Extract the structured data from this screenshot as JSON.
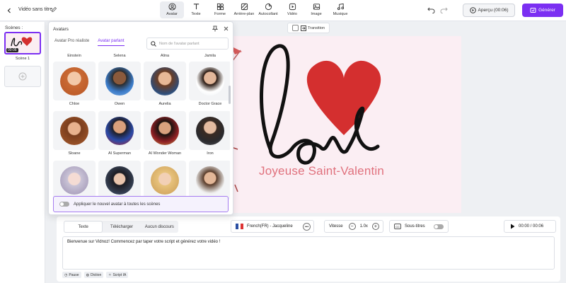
{
  "header": {
    "title": "Vidéo sans titre",
    "tools": [
      {
        "label": "Avatar",
        "icon": "user-circle-icon",
        "active": true
      },
      {
        "label": "Texte",
        "icon": "text-icon",
        "active": false
      },
      {
        "label": "Forme",
        "icon": "shapes-icon",
        "active": false
      },
      {
        "label": "Arrière-plan",
        "icon": "background-icon",
        "active": false
      },
      {
        "label": "Autocollant",
        "icon": "sticker-icon",
        "active": false
      },
      {
        "label": "Vidéo",
        "icon": "video-icon",
        "active": false
      },
      {
        "label": "Image",
        "icon": "image-icon",
        "active": false
      },
      {
        "label": "Musique",
        "icon": "music-icon",
        "active": false
      }
    ],
    "preview_label": "Aperçu (00:06)",
    "generate_label": "Générer"
  },
  "scenes": {
    "label": "Scènes :",
    "items": [
      {
        "name": "Scène 1",
        "time": "00:06"
      }
    ]
  },
  "canvas": {
    "transition_label": "Transition",
    "headline": "love",
    "subtitle": "Joyeuse Saint-Valentin"
  },
  "script": {
    "tabs": [
      "Texte",
      "Télécharger",
      "Aucun discours"
    ],
    "voice": "French(FR) - Jacqueline",
    "speed_label": "Vitesse",
    "speed_value": "1.0x",
    "subtitles_label": "Sous-titres",
    "time": "00:00 / 00:06",
    "text": "Bienvenue sur Vidnoz! Commencez par taper votre script et générez votre vidéo !",
    "chips": [
      "Pause",
      "Diction",
      "Script IA"
    ]
  },
  "avatars": {
    "title": "Avatars",
    "tabs": [
      "Avatar Pro réaliste",
      "Avatar parlant"
    ],
    "search_placeholder": "Nom de l'avatar parlant",
    "top_names": [
      "Einstein",
      "Selena",
      "Alina",
      "Jamila"
    ],
    "rows": [
      [
        "Chloe",
        "Owen",
        "Aurelia",
        "Doctor Grace"
      ],
      [
        "Sloane",
        "AI Superman",
        "AI Wonder Woman",
        "Iron"
      ],
      [
        "",
        "",
        "",
        ""
      ]
    ],
    "apply_label": "Appliquer le nouvel avatar à toutes les scènes"
  },
  "colors": {
    "accent": "#7b2ff2",
    "heart": "#d42f2f",
    "canvas_bg": "#fbeef3"
  }
}
